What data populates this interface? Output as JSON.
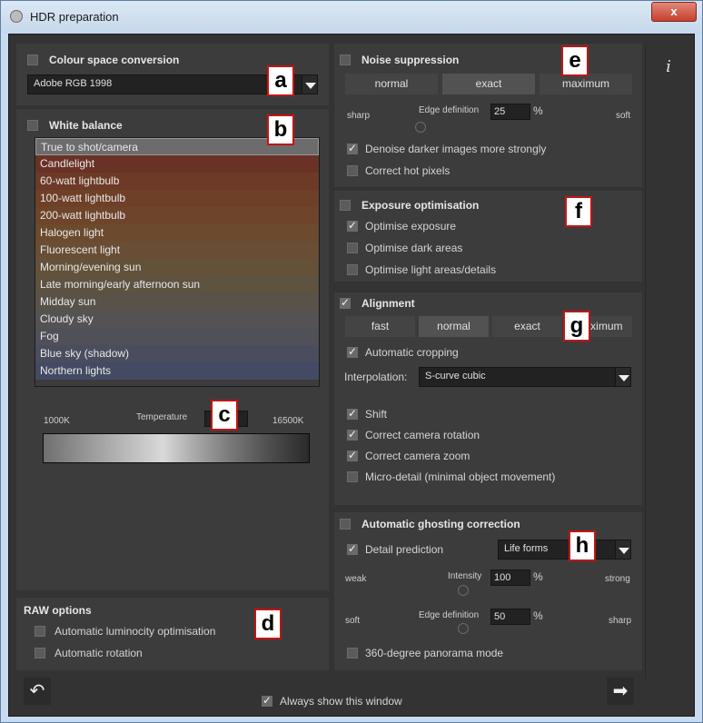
{
  "window": {
    "title": "HDR preparation",
    "close_glyph": "x"
  },
  "info_glyph": "i",
  "colour_space": {
    "title": "Colour space conversion",
    "checked": false,
    "selected": "Adobe RGB 1998",
    "marker": "a"
  },
  "white_balance": {
    "title": "White balance",
    "checked": false,
    "marker": "b",
    "items": [
      {
        "label": "True to shot/camera",
        "color": "#5c5c5c"
      },
      {
        "label": "Candlelight",
        "color": "#6a3226"
      },
      {
        "label": "60-watt lightbulb",
        "color": "#6c3a26"
      },
      {
        "label": "100-watt lightbulb",
        "color": "#6e4028"
      },
      {
        "label": "200-watt lightbulb",
        "color": "#6e442a"
      },
      {
        "label": "Halogen light",
        "color": "#6c4a2e"
      },
      {
        "label": "Fluorescent light",
        "color": "#684e34"
      },
      {
        "label": "Morning/evening sun",
        "color": "#63513a"
      },
      {
        "label": "Late morning/early afternoon sun",
        "color": "#5e5240"
      },
      {
        "label": "Midday sun",
        "color": "#585348"
      },
      {
        "label": "Cloudy sky",
        "color": "#545252"
      },
      {
        "label": "Fog",
        "color": "#4f5058"
      },
      {
        "label": "Blue sky (shadow)",
        "color": "#4a4d5e"
      },
      {
        "label": "Northern lights",
        "color": "#454a64"
      }
    ],
    "temperature": {
      "label": "Temperature",
      "min_label": "1000K",
      "max_label": "16500K",
      "marker": "c"
    }
  },
  "raw_options": {
    "title": "RAW options",
    "marker": "d",
    "items": [
      {
        "label": "Automatic luminocity optimisation",
        "checked": false
      },
      {
        "label": "Automatic rotation",
        "checked": false
      }
    ]
  },
  "noise_suppression": {
    "title": "Noise suppression",
    "checked": false,
    "marker": "e",
    "modes": [
      "normal",
      "exact",
      "maximum"
    ],
    "active_mode": "exact",
    "left_label": "sharp",
    "right_label": "soft",
    "edge_label": "Edge definition",
    "edge_value": "25",
    "unit": "%",
    "options": [
      {
        "label": "Denoise darker images more strongly",
        "checked": true
      },
      {
        "label": "Correct hot pixels",
        "checked": false
      }
    ]
  },
  "exposure": {
    "title": "Exposure optimisation",
    "checked": false,
    "marker": "f",
    "options": [
      {
        "label": "Optimise exposure",
        "checked": true
      },
      {
        "label": "Optimise dark areas",
        "checked": false
      },
      {
        "label": "Optimise light areas/details",
        "checked": false
      }
    ]
  },
  "alignment": {
    "title": "Alignment",
    "checked": true,
    "marker": "g",
    "modes": [
      "fast",
      "normal",
      "exact",
      "maximum"
    ],
    "active_mode": "normal",
    "auto_crop": {
      "label": "Automatic cropping",
      "checked": true
    },
    "interpolation_label": "Interpolation:",
    "interpolation_value": "S-curve cubic",
    "options": [
      {
        "label": "Shift",
        "checked": true
      },
      {
        "label": "Correct camera rotation",
        "checked": true
      },
      {
        "label": "Correct camera zoom",
        "checked": true
      },
      {
        "label": "Micro-detail (minimal object movement)",
        "checked": false
      }
    ]
  },
  "ghosting": {
    "title": "Automatic ghosting correction",
    "checked": false,
    "marker": "h",
    "detail_prediction": {
      "label": "Detail prediction",
      "checked": true,
      "value": "Life forms"
    },
    "intensity": {
      "left": "weak",
      "right": "strong",
      "label": "Intensity",
      "value": "100",
      "unit": "%"
    },
    "edge": {
      "left": "soft",
      "right": "sharp",
      "label": "Edge definition",
      "value": "50",
      "unit": "%"
    },
    "panorama": {
      "label": "360-degree panorama mode",
      "checked": false
    }
  },
  "footer": {
    "always_show": {
      "label": "Always show this window",
      "checked": true
    },
    "back_icon": "undo-arrow-icon",
    "next_icon": "right-arrow-icon"
  }
}
